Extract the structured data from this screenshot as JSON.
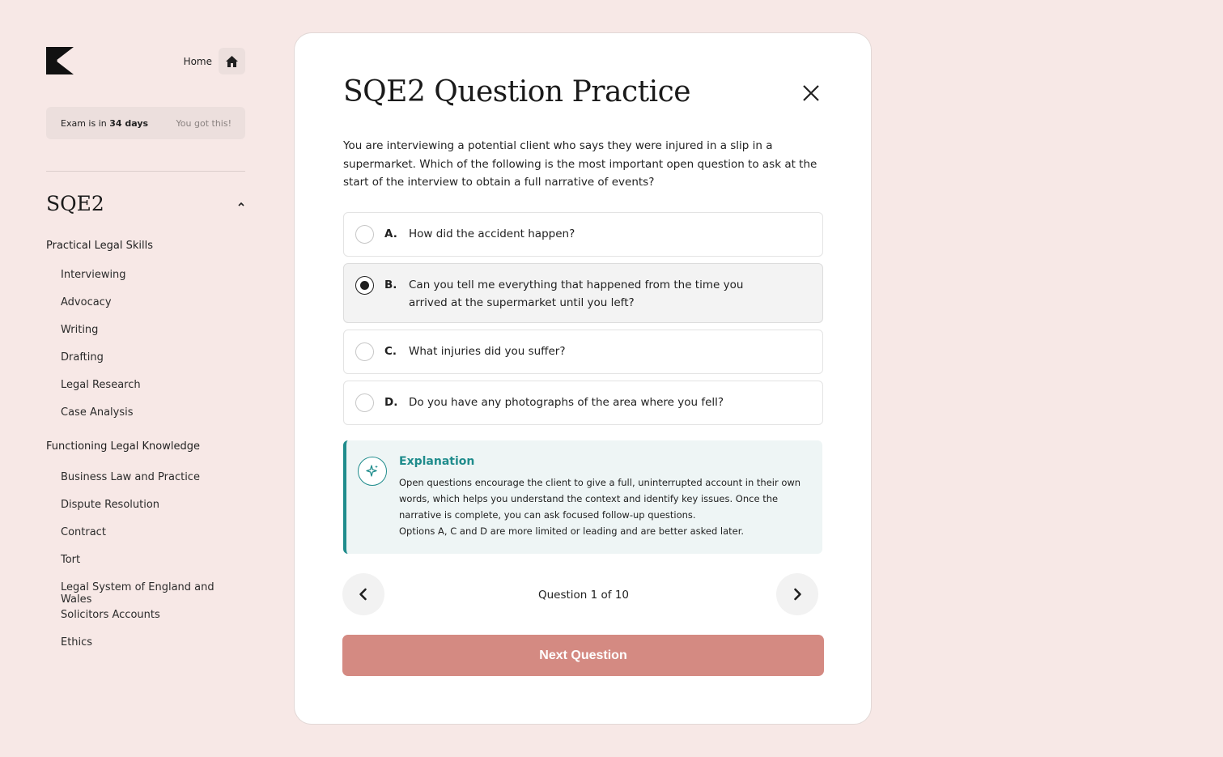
{
  "sidebar": {
    "home_label": "Home",
    "exam_prefix": "Exam is in",
    "exam_days": "34 days",
    "exam_message": "You got this!",
    "course_title": "SQE2",
    "sections": [
      {
        "heading": "Practical Legal Skills",
        "items": [
          "Interviewing",
          "Advocacy",
          "Writing",
          "Drafting",
          "Legal Research",
          "Case Analysis"
        ]
      },
      {
        "heading": "Functioning Legal Knowledge",
        "items": [
          "Business Law and Practice",
          "Dispute Resolution",
          "Contract",
          "Tort",
          "Legal System of England and Wales",
          "Solicitors Accounts",
          "Ethics"
        ]
      }
    ]
  },
  "card": {
    "title": "SQE2 Question Practice",
    "question": "You are interviewing a potential client who says they were injured in a slip in a supermarket. Which of the following is the most important open question to ask at the start of the interview to obtain a full narrative of events?",
    "options": [
      {
        "letter": "A.",
        "text": "How did the accident happen?",
        "selected": false
      },
      {
        "letter": "B.",
        "text": "Can you tell me everything that happened from the time you arrived at the supermarket until you left?",
        "selected": true
      },
      {
        "letter": "C.",
        "text": "What injuries did you suffer?",
        "selected": false
      },
      {
        "letter": "D.",
        "text": "Do you have any photographs of the area where you fell?",
        "selected": false
      }
    ],
    "explanation": {
      "title": "Explanation",
      "text_1": "Open questions encourage the client to give a full, uninterrupted account in their own words, which helps you understand the context and identify key issues. Once the narrative is complete, you can ask focused follow-up questions.",
      "text_2": "Options A, C and D are more limited or leading and are better asked later."
    },
    "counter": "Question 1 of 10",
    "next_label": "Next Question"
  },
  "colors": {
    "background": "#f7e8e6",
    "accent_teal": "#1f8c8c",
    "next_button": "#d48a82"
  }
}
